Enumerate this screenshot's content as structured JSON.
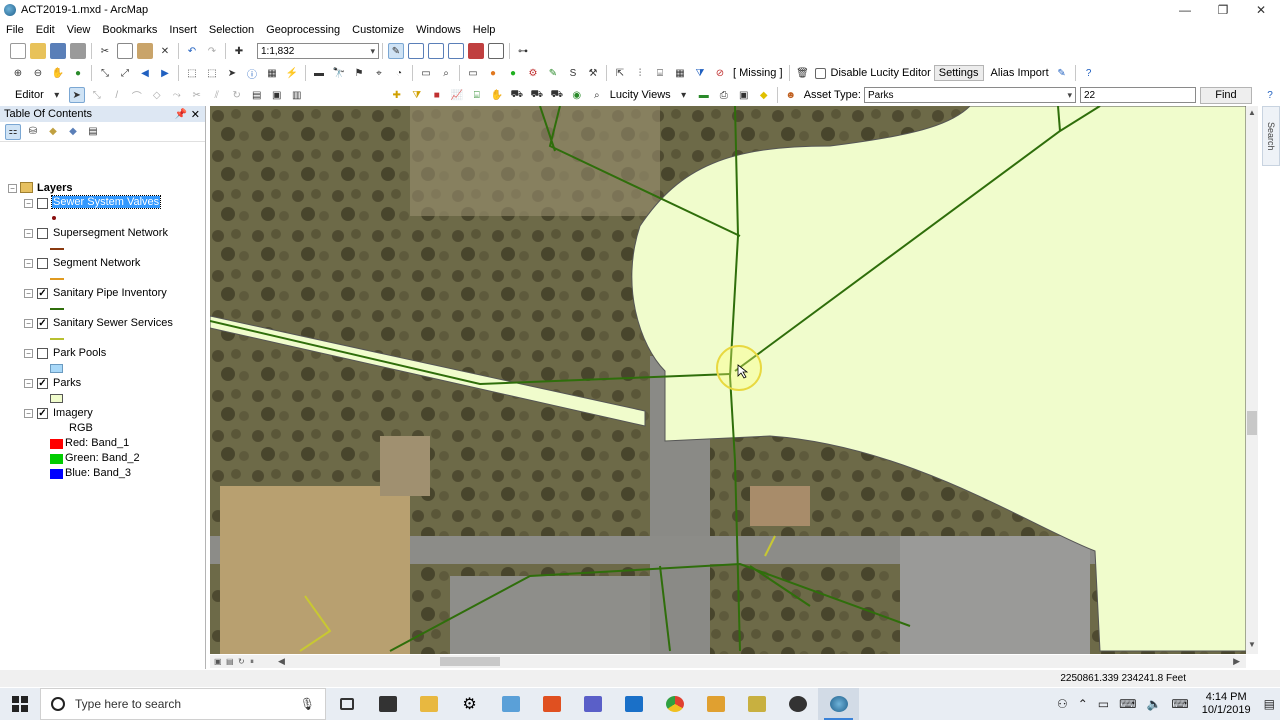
{
  "window": {
    "title": "ACT2019-1.mxd - ArcMap",
    "minimize": "—",
    "maximize": "❐",
    "close": "✕"
  },
  "menu": [
    "File",
    "Edit",
    "View",
    "Bookmarks",
    "Insert",
    "Selection",
    "Geoprocessing",
    "Customize",
    "Windows",
    "Help"
  ],
  "toolbar1": {
    "scale": "1:1,832"
  },
  "toolbar2": {
    "missing_label": "[ Missing ]",
    "disable_lucity_label": "Disable Lucity Editor",
    "settings_label": "Settings",
    "alias_import_label": "Alias Import"
  },
  "toolbar3": {
    "editor_label": "Editor",
    "lucity_views_label": "Lucity Views",
    "asset_type_label": "Asset Type:",
    "asset_type_value": "Parks",
    "find_value": "22",
    "find_label": "Find"
  },
  "toc": {
    "title": "Table Of Contents",
    "root": "Layers",
    "layers": [
      {
        "name": "Sewer System Valves",
        "checked": false,
        "selected": true
      },
      {
        "name": "Supersegment Network",
        "checked": false
      },
      {
        "name": "Segment Network",
        "checked": false
      },
      {
        "name": "Sanitary Pipe Inventory",
        "checked": true
      },
      {
        "name": "Sanitary Sewer Services",
        "checked": true
      },
      {
        "name": "Park Pools",
        "checked": false
      },
      {
        "name": "Parks",
        "checked": true
      },
      {
        "name": "Imagery",
        "checked": true
      }
    ],
    "imagery_legend": {
      "rgb_label": "RGB",
      "bands": [
        {
          "label": "Red:   Band_1",
          "color": "#ff0000"
        },
        {
          "label": "Green: Band_2",
          "color": "#00cc00"
        },
        {
          "label": "Blue:  Band_3",
          "color": "#0000ff"
        }
      ]
    }
  },
  "status": {
    "coordinates": "2250861.339  234241.8 Feet"
  },
  "search_tab": "Search",
  "taskbar": {
    "search_placeholder": "Type here to search",
    "time": "4:14 PM",
    "date": "10/1/2019"
  },
  "colors": {
    "park_fill": "#f0fccc",
    "pipe_line": "#2f6e0b",
    "service_line": "#c8c832",
    "selection_highlight": "#3399ff"
  }
}
